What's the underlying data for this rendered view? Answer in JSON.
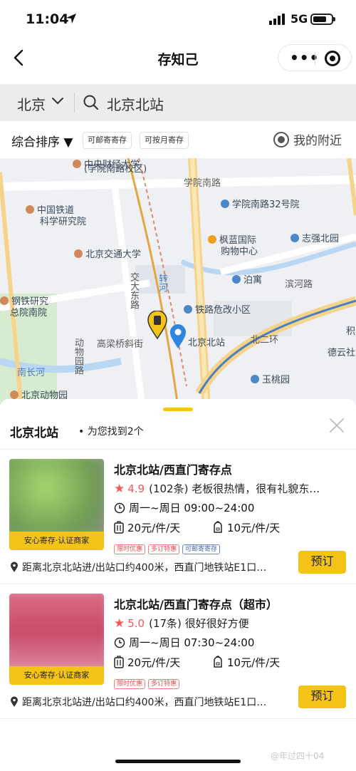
{
  "status": {
    "time": "11:04",
    "network": "5G"
  },
  "nav": {
    "title": "存知己",
    "more": "•••"
  },
  "search": {
    "city": "北京",
    "query": "北京北站"
  },
  "filters": {
    "sort": "综合排序 ▼",
    "chip1": "可邮寄寄存",
    "chip2": "可按月寄存",
    "nearby": "我的附近"
  },
  "map": {
    "labels": [
      "中央财经大学",
      "(学院南路校区)",
      "学院南路",
      "学院南路32号院",
      "中国铁道",
      "科学研究院",
      "枫蓝国际",
      "购物中心",
      "志强北园",
      "北京交通大学",
      "泊寓",
      "滨河路",
      "钢铁研究",
      "总院南院",
      "交大东路",
      "转河",
      "铁路危改小区",
      "北京北站",
      "积",
      "北二环",
      "德云社",
      "动物园路",
      "高梁桥斜街",
      "南长河",
      "玉桃园",
      "北京动物园"
    ]
  },
  "sheet": {
    "title": "北京北站",
    "subtitle": "• 为您找到2个"
  },
  "cards": [
    {
      "name": "北京北站/西直门寄存点",
      "score": "4.9",
      "reviews": "(102条)",
      "comment": "老板很热情，很有礼貌东…",
      "hours": "周一~周日 09:00~24:00",
      "price_luggage": "20元/件/天",
      "price_bag": "10元/件/天",
      "badge": "安心寄存·认证商家",
      "tags": [
        "限时优惠",
        "多订特惠",
        "可邮寄寄存"
      ],
      "address": "距离北京北站进/出站口约400米，西直门地铁站E1口…",
      "book": "预订",
      "thumb_color": "#8cc06a"
    },
    {
      "name": "北京北站/西直门寄存点（超市）",
      "score": "5.0",
      "reviews": "(17条)",
      "comment": "很好很好方便",
      "hours": "周一~周日 07:30~24:00",
      "price_luggage": "20元/件/天",
      "price_bag": "10元/件/天",
      "badge": "安心寄存·认证商家",
      "tags": [
        "限时优惠",
        "多订特惠"
      ],
      "address": "距离北京北站进/出站口约400米，西直门地铁站E1口…",
      "book": "预订",
      "thumb_color": "#d8607a"
    }
  ],
  "watermark": "@年过四十04"
}
